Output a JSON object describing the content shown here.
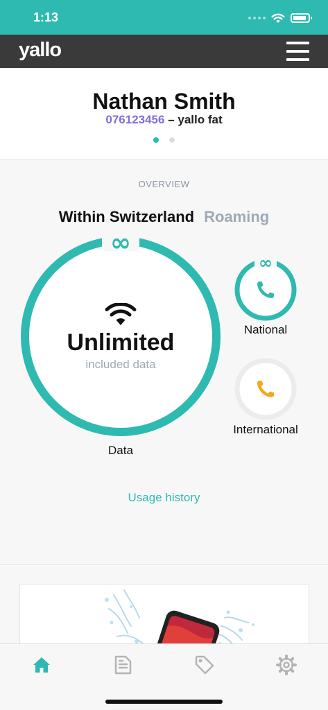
{
  "status_bar": {
    "time": "1:13",
    "background": "#2fbab1"
  },
  "header": {
    "logo": "yallo",
    "menu_icon": "hamburger-menu-icon",
    "background": "#3a3a3a"
  },
  "profile": {
    "name": "Nathan Smith",
    "phone_number": "076123456",
    "plan_separator": " – ",
    "plan_name": "yallo fat",
    "page_count": 2,
    "active_page": 1
  },
  "overview": {
    "title": "OVERVIEW",
    "tabs": [
      {
        "label": "Within Switzerland",
        "active": true
      },
      {
        "label": "Roaming",
        "active": false
      }
    ],
    "data": {
      "value": "Unlimited",
      "caption": "included data",
      "label": "Data",
      "unlimited_symbol": "∞",
      "icon": "wifi-icon"
    },
    "national": {
      "label": "National",
      "unlimited_symbol": "∞",
      "icon": "phone-icon"
    },
    "international": {
      "label": "International",
      "icon": "phone-icon"
    },
    "usage_history_link": "Usage history"
  },
  "tab_bar": {
    "items": [
      {
        "name": "home",
        "icon": "home-icon",
        "active": true
      },
      {
        "name": "invoices",
        "icon": "document-icon",
        "active": false
      },
      {
        "name": "offers",
        "icon": "tag-icon",
        "active": false
      },
      {
        "name": "settings",
        "icon": "gear-icon",
        "active": false
      }
    ]
  },
  "colors": {
    "accent": "#2fbab1",
    "phone_number": "#7f6fdc",
    "international_icon": "#f2a91f",
    "muted_text": "#9eaab6"
  }
}
